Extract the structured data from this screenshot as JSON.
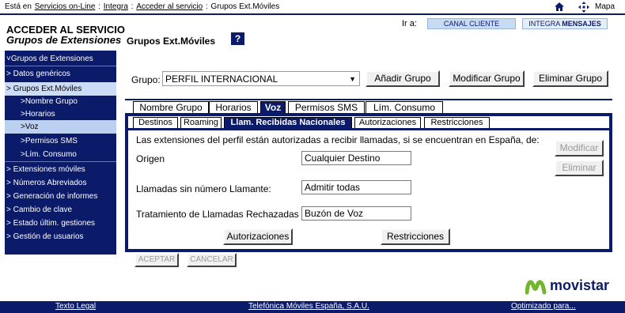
{
  "topbar": {
    "label": "Está en",
    "crumbs": [
      "Servicios on-Line",
      "Integra",
      "Acceder al servicio",
      "Grupos Ext.Móviles"
    ],
    "mapa": "Mapa"
  },
  "service": {
    "title": "ACCEDER AL SERVICIO",
    "subtitle": "Grupos de Extensiones"
  },
  "sidebar": {
    "items": [
      {
        "label": "˅Grupos de Extensiones"
      },
      {
        "label": "> Datos genéricos"
      },
      {
        "label": "> Grupos Ext.Móviles"
      },
      {
        "label": ">Nombre Grupo"
      },
      {
        "label": ">Horarios"
      },
      {
        "label": ">Voz"
      },
      {
        "label": ">Permisos SMS"
      },
      {
        "label": ">Lím. Consumo"
      },
      {
        "label": "> Extensiones móviles"
      },
      {
        "label": "> Números Abreviados"
      },
      {
        "label": "> Generación de informes"
      },
      {
        "label": "> Cambio de clave"
      },
      {
        "label": "> Estado últim. gestiones"
      },
      {
        "label": "> Gestión de usuarios"
      }
    ]
  },
  "ira": {
    "label": "Ir a:",
    "canal": "CANAL CLIENTE",
    "integra_a": "INTEGRA",
    "integra_b": "MENSAJES"
  },
  "page": {
    "title": "Grupos Ext.Móviles",
    "help": "?"
  },
  "grupo": {
    "label": "Grupo:",
    "value": "PERFIL INTERNACIONAL",
    "add": "Añadir Grupo",
    "modify": "Modificar Grupo",
    "delete": "Eliminar Grupo"
  },
  "tabs": [
    "Nombre Grupo",
    "Horarios",
    "Voz",
    "Permisos SMS",
    "Lím. Consumo"
  ],
  "subtabs": [
    "Destinos",
    "Roaming",
    "Llam. Recibidas Nacionales",
    "Autorizaciones",
    "Restricciones"
  ],
  "panel": {
    "description": "Las extensiones del perfil están autorizadas a recibir llamadas, si se encuentran en España, de:",
    "modificar": "Modificar",
    "eliminar": "Eliminar",
    "fields": [
      {
        "label": "Origen",
        "value": "Cualquier Destino"
      },
      {
        "label": "Llamadas sin número Llamante:",
        "value": "Admitir todas"
      },
      {
        "label": "Tratamiento de Llamadas Rechazadas:",
        "value": "Buzón de Voz"
      }
    ],
    "autorizaciones": "Autorizaciones",
    "restricciones": "Restricciones",
    "aceptar": "ACEPTAR",
    "cancelar": "CANCELAR"
  },
  "brand": {
    "name": "movistar",
    "color": "#0b1b6a",
    "accent": "#72b72b"
  },
  "footer": {
    "legal": "Texto Legal",
    "company": "Telefónica Móviles España, S.A.U.",
    "optimized": "Optimizado para..."
  }
}
